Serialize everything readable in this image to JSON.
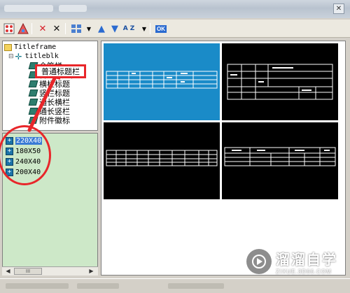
{
  "toolbar": {
    "icons": [
      "select-all-icon",
      "palette-icon",
      "delete-red-icon",
      "delete-black-icon",
      "view-grid-icon",
      "move-up-icon",
      "move-down-icon",
      "sort-az-icon",
      "ok-icon"
    ],
    "ok_label": "OK",
    "sort_label": "A Z"
  },
  "tree": {
    "root": "Titleframe",
    "child": "titleblk",
    "items": [
      "会签栏",
      "普通标题栏",
      "横栏标题",
      "竖栏标题",
      "通长横栏",
      "通长竖栏",
      "附件徽标"
    ]
  },
  "list": {
    "items": [
      "220X40",
      "180X50",
      "240X40",
      "200X40"
    ],
    "selected": "220X40"
  },
  "scrollbar": {
    "thumb_label": "III"
  },
  "callout": {
    "label": "普通标题栏"
  },
  "colors": {
    "highlight": "#e8262a",
    "selected_thumb": "#1a8bc8",
    "list_bg": "#cde8c8"
  },
  "watermark": {
    "name": "溜溜自学",
    "url": "ZIXUE.3D66.COM"
  }
}
